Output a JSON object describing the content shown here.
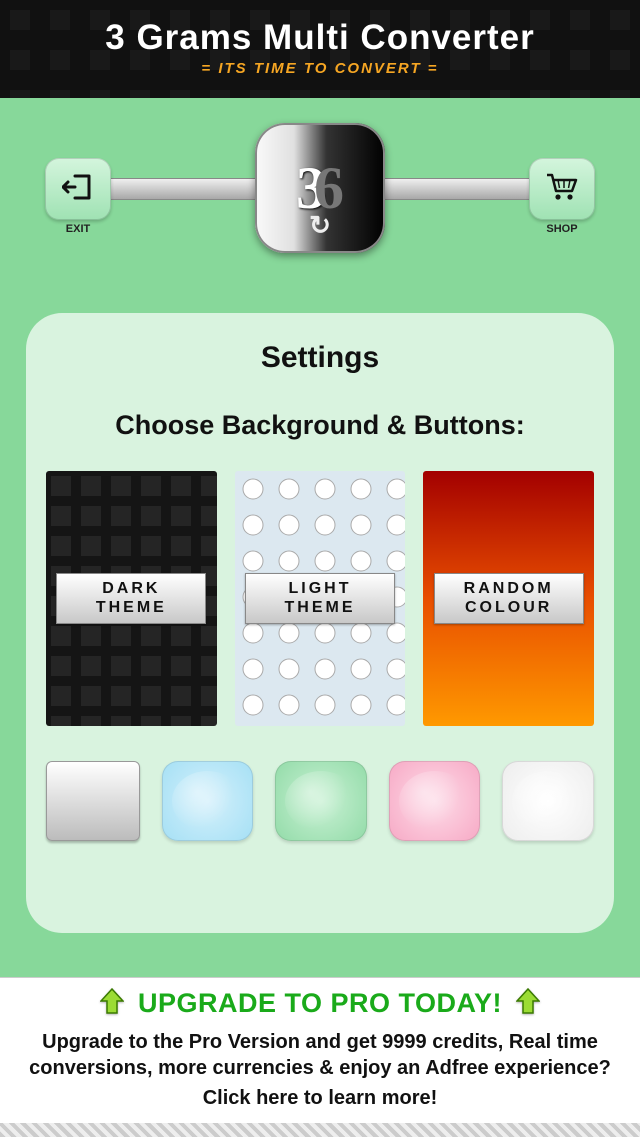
{
  "header": {
    "title": "3 Grams Multi Converter",
    "subtitle": "= ITS TIME TO CONVERT ="
  },
  "nav": {
    "exit_label": "EXIT",
    "shop_label": "SHOP",
    "logo_left": "3",
    "logo_right": "6"
  },
  "panel": {
    "title": "Settings",
    "subtitle": "Choose Background & Buttons:",
    "themes": {
      "dark": "DARK THEME",
      "light": "LIGHT THEME",
      "random": "RANDOM COLOUR"
    },
    "swatches": [
      "silver",
      "blue",
      "green",
      "pink",
      "white"
    ]
  },
  "footer": {
    "title": "UPGRADE TO PRO TODAY!",
    "body": "Upgrade to the Pro Version and get 9999 credits, Real time conversions, more currencies & enjoy an Adfree experience?",
    "link": "Click here to learn more!"
  }
}
